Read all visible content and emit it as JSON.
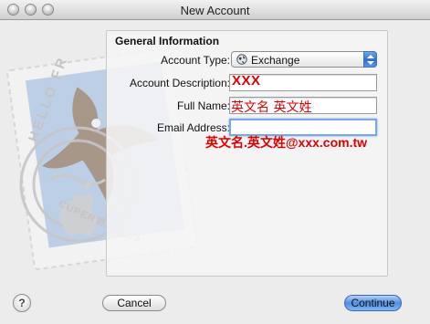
{
  "window": {
    "title": "New Account"
  },
  "stamp": {
    "text_top": "HELLO FR",
    "text_bottom": "CUPERTINO, CA"
  },
  "panel": {
    "title": "General Information",
    "account_type": {
      "label": "Account Type:",
      "value": "Exchange",
      "icon": "globe-icon"
    },
    "account_description": {
      "label": "Account Description:",
      "value": "XXX"
    },
    "full_name": {
      "label": "Full Name:",
      "value": "英文名 英文姓"
    },
    "email_address": {
      "label": "Email Address:",
      "value": ""
    }
  },
  "annotation": {
    "email_text": "英文名.英文姓@xxx.com.tw"
  },
  "buttons": {
    "help": "?",
    "cancel": "Cancel",
    "continue": "Continue"
  },
  "colors": {
    "annotation_red": "#e00000",
    "focus_blue": "#7aa7e9",
    "default_button_blue": "#4d8de6"
  }
}
